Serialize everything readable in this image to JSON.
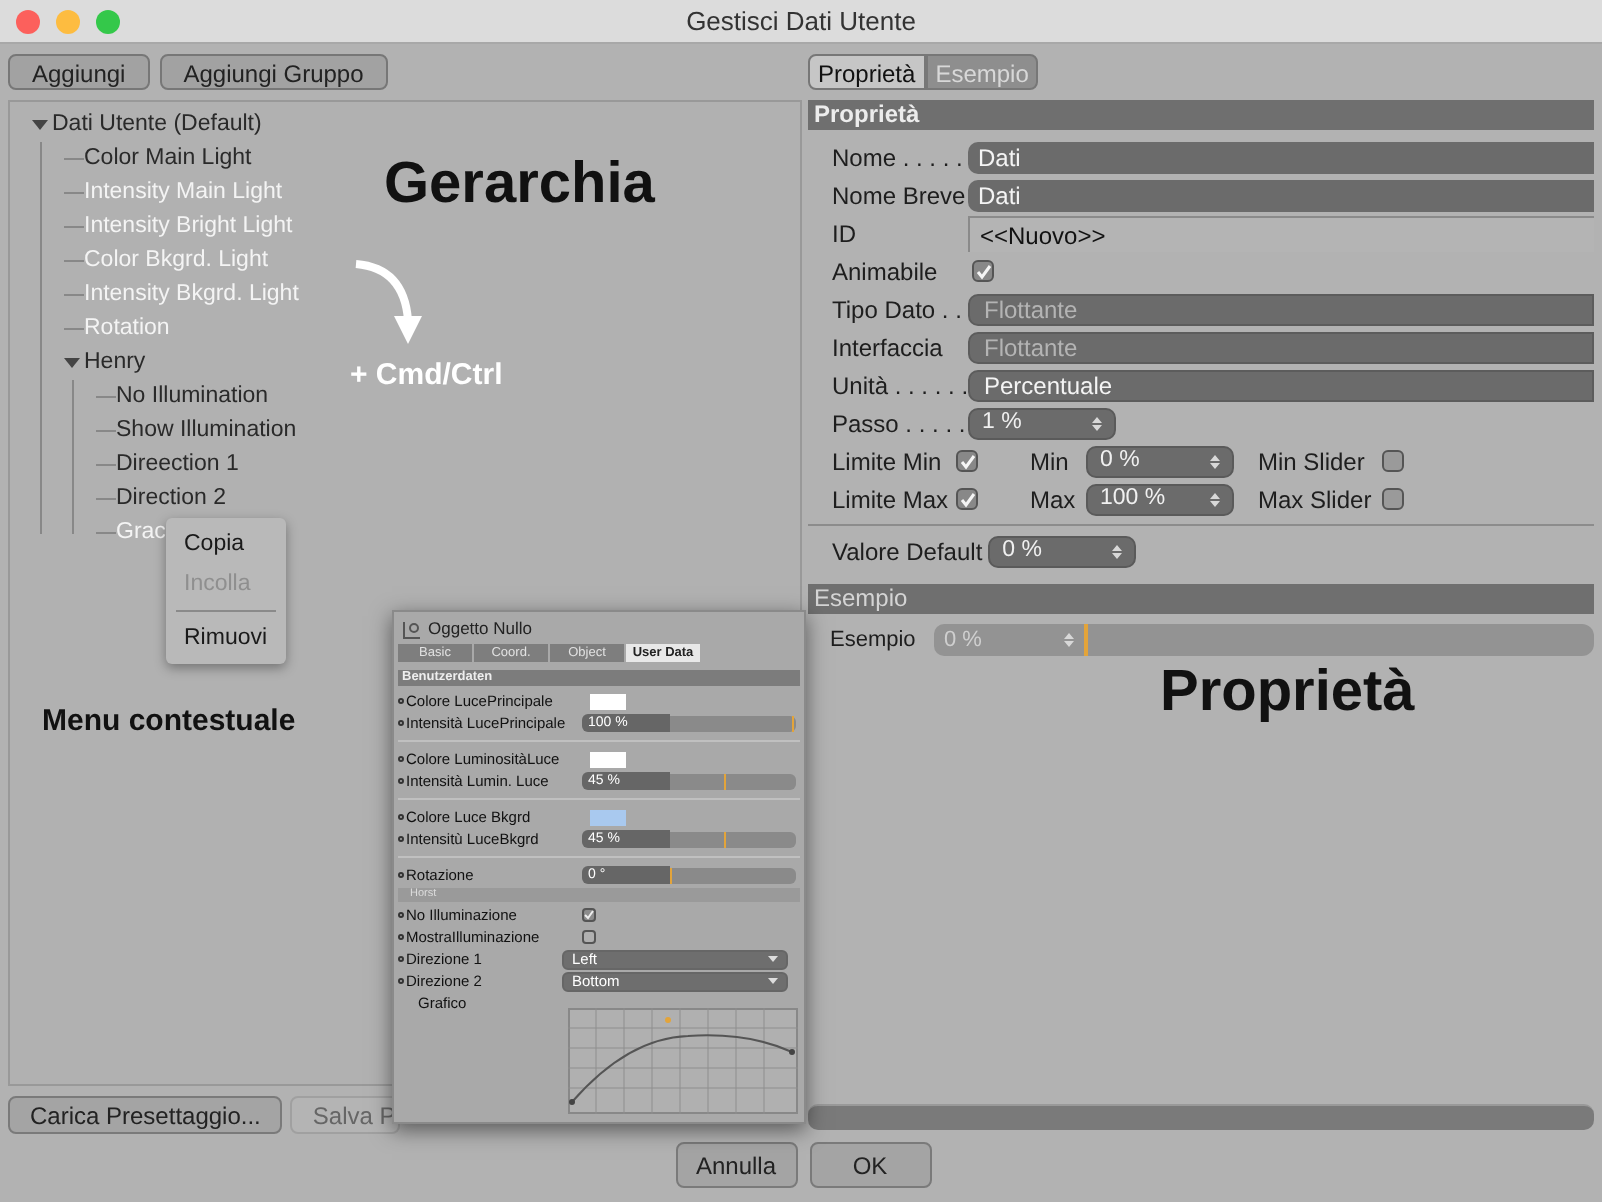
{
  "window": {
    "title": "Gestisci Dati Utente"
  },
  "left_panel": {
    "buttons": [
      "Aggiungi",
      "Aggiungi Gruppo"
    ],
    "tree": [
      {
        "label": "Dati Utente (Default)",
        "selected": false,
        "expanded": true,
        "children": [
          {
            "label": "Color Main Light",
            "selected": false
          },
          {
            "label": "Intensity Main Light",
            "selected": true
          },
          {
            "label": "Intensity Bright Light",
            "selected": true
          },
          {
            "label": "Color Bkgrd. Light",
            "selected": true
          },
          {
            "label": "Intensity Bkgrd. Light",
            "selected": true
          },
          {
            "label": "Rotation",
            "selected": true
          },
          {
            "label": "Henry",
            "selected": false,
            "expanded": true,
            "children": [
              {
                "label": "No Illumination",
                "selected": false
              },
              {
                "label": "Show Illumination",
                "selected": false
              },
              {
                "label": "Direection 1",
                "selected": false
              },
              {
                "label": "Direction 2",
                "selected": false
              },
              {
                "label": "Grac",
                "selected": true
              }
            ]
          }
        ]
      }
    ],
    "bottom_buttons": [
      {
        "label": "Carica Presettaggio...",
        "disabled": false
      },
      {
        "label": "Salva P",
        "disabled": true
      }
    ]
  },
  "context_menu": {
    "items": [
      {
        "kind": "item",
        "label": "Copia",
        "disabled": false
      },
      {
        "kind": "item",
        "label": "Incolla",
        "disabled": true
      },
      {
        "kind": "separator"
      },
      {
        "kind": "item",
        "label": "Rimuovi",
        "disabled": false
      }
    ]
  },
  "annotations": {
    "hierarchy": "Gerarchia",
    "modifier": "+ Cmd/Ctrl",
    "context_menu": "Menu contestuale",
    "properties": "Proprietà"
  },
  "right_panel": {
    "tabs": [
      {
        "label": "Proprietà",
        "selected": true
      },
      {
        "label": "Esempio",
        "selected": false
      }
    ],
    "section_title": "Proprietà",
    "fields": [
      {
        "kind": "text",
        "label": "Nome . . . . .",
        "value": "Dati"
      },
      {
        "kind": "text",
        "label": "Nome Breve",
        "value": "Dati"
      },
      {
        "kind": "plain",
        "label": "ID",
        "value": "<<Nuovo>>"
      },
      {
        "kind": "checkbox",
        "label": "Animabile",
        "checked": true
      },
      {
        "kind": "dropdown",
        "label": "Tipo Dato . .",
        "value": "Flottante",
        "disabled": true
      },
      {
        "kind": "dropdown",
        "label": "Interfaccia",
        "value": "Flottante",
        "disabled": true
      },
      {
        "kind": "dropdown",
        "label": "Unità . . . . . .",
        "value": "Percentuale",
        "disabled": false
      },
      {
        "kind": "number",
        "label": "Passo . . . . .",
        "value": "1 %"
      },
      {
        "kind": "limit",
        "label": "Limite Min",
        "checked": true,
        "field_label": "Min",
        "value": "0 %",
        "slider_label": "Min Slider",
        "slider_checked": false
      },
      {
        "kind": "limit",
        "label": "Limite Max",
        "checked": true,
        "field_label": "Max",
        "value": "100 %",
        "slider_label": "Max Slider",
        "slider_checked": false
      }
    ],
    "default": {
      "label": "Valore Default",
      "value": "0 %"
    },
    "example": {
      "title": "Esempio",
      "label": "Esempio",
      "value": "0 %",
      "level": 0
    }
  },
  "object_panel": {
    "title": "Oggetto Nullo",
    "tabs": [
      {
        "label": "Basic",
        "selected": false
      },
      {
        "label": "Coord.",
        "selected": false
      },
      {
        "label": "Object",
        "selected": false
      },
      {
        "label": "User Data",
        "selected": true
      }
    ],
    "section_title": "Benutzerdaten",
    "rows": [
      {
        "kind": "color",
        "label": "Colore LucePrincipale",
        "color": "#ffffff"
      },
      {
        "kind": "slider",
        "label": "Intensità LucePrincipale",
        "value": "100 %",
        "level": 1
      },
      {
        "kind": "separator"
      },
      {
        "kind": "color",
        "label": "Colore LuminositàLuce",
        "color": "#ffffff"
      },
      {
        "kind": "slider",
        "label": "Intensità Lumin. Luce",
        "value": "45 %",
        "level": 0.45
      },
      {
        "kind": "separator"
      },
      {
        "kind": "color",
        "label": "Colore Luce Bkgrd",
        "color": "#a9c9ef"
      },
      {
        "kind": "slider",
        "label": "Intensitù LuceBkgrd",
        "value": "45 %",
        "level": 0.45
      },
      {
        "kind": "separator"
      },
      {
        "kind": "slider",
        "label": "Rotazione",
        "value": "0 °",
        "level": 0
      },
      {
        "kind": "group",
        "label": "Horst"
      },
      {
        "kind": "checkbox",
        "label": "No Illuminazione",
        "checked": true
      },
      {
        "kind": "checkbox",
        "label": "MostraIlluminazione",
        "checked": false
      },
      {
        "kind": "dropdown",
        "label": "Direzione 1",
        "value": "Left"
      },
      {
        "kind": "dropdown",
        "label": "Direzione 2",
        "value": "Bottom"
      },
      {
        "kind": "graph",
        "label": "Grafico"
      }
    ]
  },
  "footer_buttons": [
    "Annulla",
    "OK"
  ]
}
